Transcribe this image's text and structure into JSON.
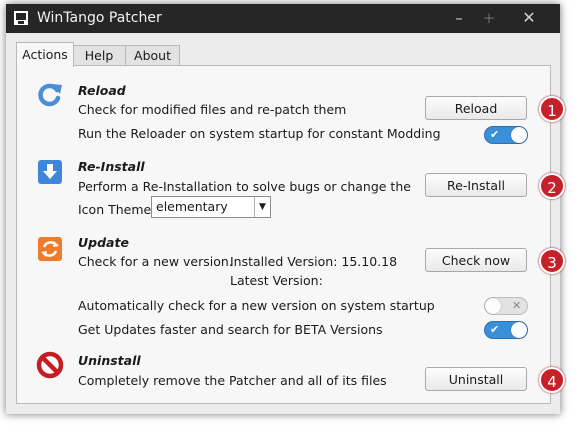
{
  "window": {
    "title": "WinTango Patcher",
    "minimize": "–",
    "maximize": "+",
    "close": "✕"
  },
  "tabs": [
    {
      "label": "Actions",
      "active": true
    },
    {
      "label": "Help"
    },
    {
      "label": "About"
    }
  ],
  "reload": {
    "title": "Reload",
    "description": "Check for modified files and re-patch them",
    "button": "Reload",
    "badge": "1",
    "startup_label": "Run the Reloader on system startup for constant Modding",
    "startup_toggle": "on"
  },
  "reinstall": {
    "title": "Re-Install",
    "description": "Perform a Re-Installation to solve bugs or change the",
    "button": "Re-Install",
    "badge": "2",
    "theme_label": "Icon Theme:",
    "theme_value": "elementary"
  },
  "update": {
    "title": "Update",
    "description": "Check for a new version.",
    "installed": "Installed Version: 15.10.18",
    "latest": "Latest Version:",
    "button": "Check now",
    "badge": "3",
    "auto_check_label": "Automatically check for a new version on system startup",
    "auto_check_toggle": "off",
    "beta_label": "Get Updates faster and search for BETA Versions",
    "beta_toggle": "on"
  },
  "uninstall": {
    "title": "Uninstall",
    "description": "Completely remove the Patcher and all of its files",
    "button": "Uninstall",
    "badge": "4"
  },
  "colors": {
    "badge": "#c6202a",
    "toggle_on": "#3a8fd9",
    "titlebar": "#262626"
  },
  "icons": {
    "reload": "refresh-icon",
    "reinstall": "download-icon",
    "update": "update-icon",
    "uninstall": "prohibited-icon"
  }
}
